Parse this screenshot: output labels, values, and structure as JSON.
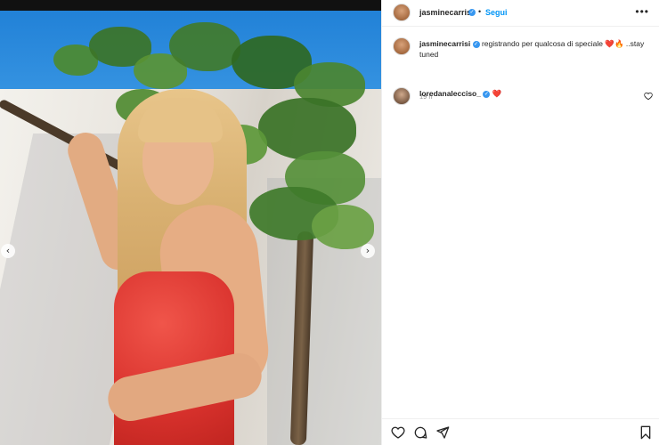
{
  "post": {
    "author": "jasminecarrisi",
    "follow_label": "Segui",
    "separator": "•",
    "more_label": "•••",
    "caption_author": "jasminecarrisi",
    "caption_text": "registrando per qualcosa di speciale ❤️🔥 ..stay tuned",
    "time_ago": "19 h"
  },
  "comments": [
    {
      "author": "loredanalecciso_",
      "text": "❤️"
    }
  ],
  "carousel": {
    "prev_label": "‹",
    "next_label": "›"
  },
  "colors": {
    "link": "#0095f6",
    "verified": "#3897f0",
    "heart": "#e0245e"
  },
  "icons": [
    "heart-icon",
    "comment-icon",
    "share-icon",
    "bookmark-icon",
    "verified-icon",
    "more-icon"
  ]
}
